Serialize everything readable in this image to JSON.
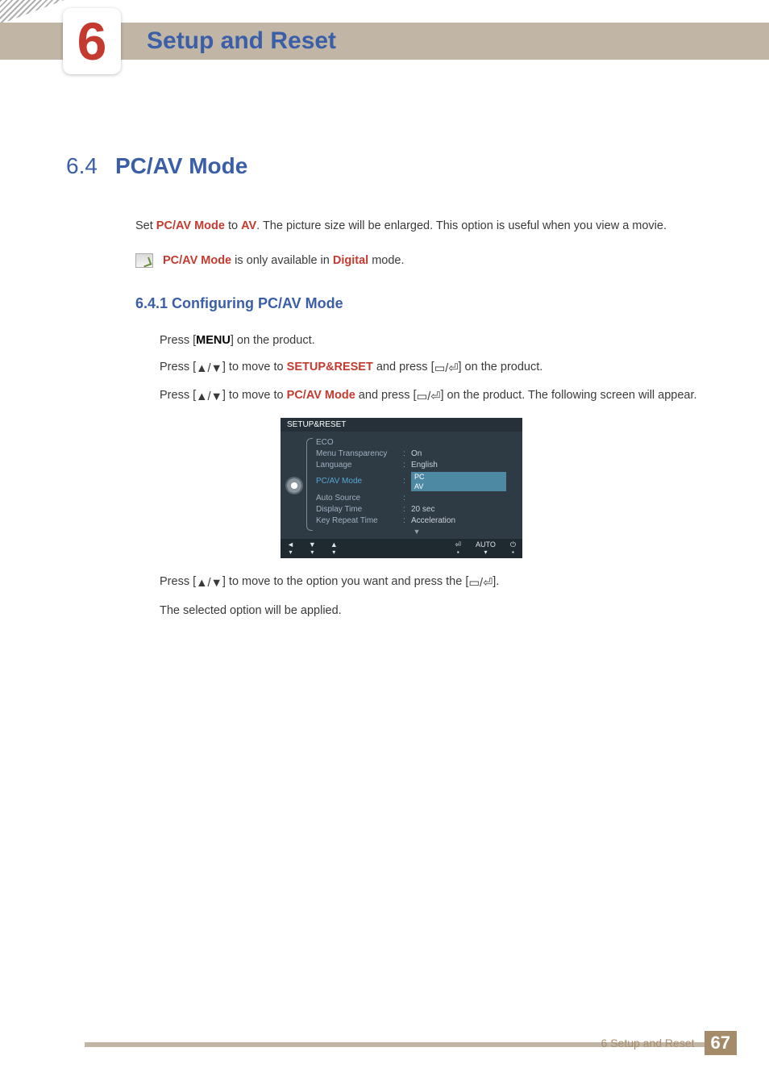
{
  "chapter": {
    "number": "6",
    "title": "Setup and Reset"
  },
  "section": {
    "number": "6.4",
    "title": "PC/AV Mode"
  },
  "intro": {
    "prefix": "Set ",
    "kw1": "PC/AV Mode",
    "mid": " to ",
    "kw2": "AV",
    "suffix": ". The picture size will be enlarged. This option is useful when you view a movie."
  },
  "note": {
    "kw1": "PC/AV Mode",
    "mid": " is only available in ",
    "kw2": "Digital",
    "suffix": " mode."
  },
  "subsection": "6.4.1   Configuring PC/AV Mode",
  "steps": {
    "s1a": "Press [",
    "s1b": "MENU",
    "s1c": "] on the product.",
    "s2a": "Press [",
    "s2b": "] to move to ",
    "s2kw": "SETUP&RESET",
    "s2c": " and press [",
    "s2d": "] on the product.",
    "s3a": "Press [",
    "s3b": "] to move to ",
    "s3kw": "PC/AV Mode",
    "s3c": " and press [",
    "s3d": "] on the product. The following screen will appear.",
    "s4a": "Press [",
    "s4b": "] to move to the option you want and press the [",
    "s4c": "].",
    "s5": "The selected option will be applied."
  },
  "osd": {
    "title": "SETUP&RESET",
    "rows": [
      {
        "label": "ECO",
        "value": ""
      },
      {
        "label": "Menu Transparency",
        "value": "On"
      },
      {
        "label": "Language",
        "value": "English"
      },
      {
        "label": "PC/AV Mode",
        "value": "",
        "highlight": true,
        "options": [
          "PC",
          "AV"
        ]
      },
      {
        "label": "Auto Source",
        "value": ""
      },
      {
        "label": "Display Time",
        "value": "20 sec"
      },
      {
        "label": "Key Repeat Time",
        "value": "Acceleration"
      }
    ],
    "footer": {
      "auto": "AUTO"
    }
  },
  "footer": {
    "text": "6 Setup and Reset",
    "page": "67"
  }
}
